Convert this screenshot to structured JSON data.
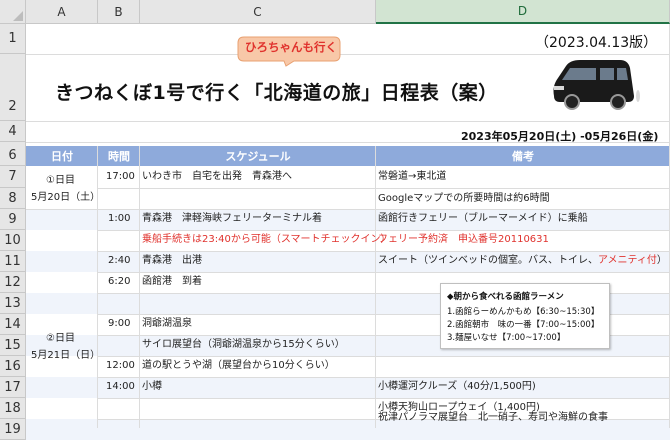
{
  "columns": [
    "A",
    "B",
    "C",
    "D"
  ],
  "rows": [
    "1",
    "2",
    "4",
    "6",
    "7",
    "8",
    "9",
    "10",
    "11",
    "12",
    "13",
    "14",
    "15",
    "16",
    "17",
    "18",
    "19"
  ],
  "title": "きつねくぼ1号で行く「北海道の旅」日程表（案）",
  "callout": "ひろちゃんも行く",
  "version": "（2023.04.13版）",
  "date_range": "2023年05月20日(土) -05月26日(金)",
  "headers": {
    "day": "日付",
    "time": "時間",
    "schedule": "スケジュール",
    "notes": "備考"
  },
  "day1": {
    "label": "①日目",
    "date": "5月20日（土）"
  },
  "day2": {
    "label": "②日目",
    "date": "5月21日（日）"
  },
  "entries": {
    "r7": {
      "time": "17:00",
      "schedule": "いわき市　自宅を出発　青森港へ",
      "note": "常磐道→東北道"
    },
    "r8": {
      "note": "Googleマップでの所要時間は約6時間"
    },
    "r9": {
      "time": "1:00",
      "schedule": "青森港　津軽海峡フェリーターミナル着",
      "note": "函館行きフェリー（ブルーマーメイド）に乗船"
    },
    "r10": {
      "schedule": "乗船手続きは23:40から可能（スマートチェックイン）",
      "note": "フェリー予約済　申込番号20110631"
    },
    "r11": {
      "time": "2:40",
      "schedule": "青森港　出港",
      "note_a": "スイート（ツインベッドの個室。バス、トイレ、",
      "note_b": "アメニティ付",
      "note_c": "）"
    },
    "r12": {
      "time": "6:20",
      "schedule": "函館港　到着"
    },
    "r14": {
      "time": "9:00",
      "schedule": "洞爺湖温泉"
    },
    "r15": {
      "schedule": "サイロ展望台（洞爺湖温泉から15分くらい）"
    },
    "r16": {
      "time": "12:00",
      "schedule": "道の駅とうや湖（展望台から10分くらい）"
    },
    "r17": {
      "time": "14:00",
      "schedule": "小樽",
      "note": "小樽運河クルーズ（40分/1,500円)"
    },
    "r18": {
      "note": "小樽天狗山ロープウェイ（1,400円)"
    },
    "r19": {
      "note": "祝津パノラマ展望台　北一硝子、寿司や海鮮の食事"
    }
  },
  "ramen_note": {
    "title": "◆朝から食べれる函館ラーメン",
    "items": [
      "1.函館らーめんかもめ【6:30~15:30】",
      "2.函館朝市　味の一番【7:00~15:00】",
      "3.麺屋いなせ【7:00~17:00】"
    ]
  },
  "colors": {
    "header_band": "#8eaadb",
    "selected_column": "#217346",
    "red_text": "#e0322d",
    "callout": "#f8c8a8"
  }
}
